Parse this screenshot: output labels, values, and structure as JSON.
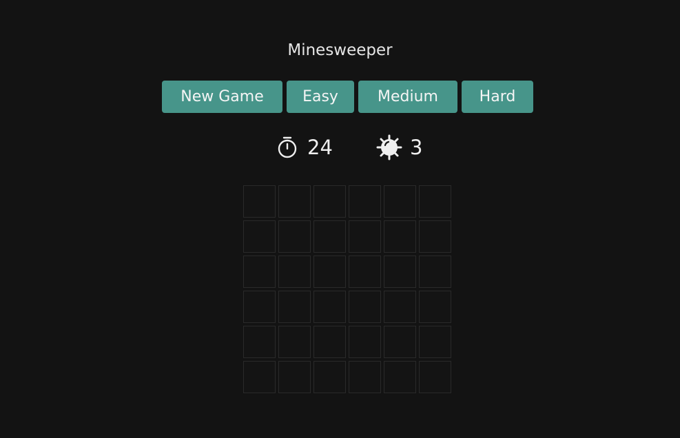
{
  "game": {
    "title": "Minesweeper"
  },
  "toolbar": {
    "buttons": [
      {
        "key": "new",
        "label": "New Game"
      },
      {
        "key": "easy",
        "label": "Easy"
      },
      {
        "key": "medium",
        "label": "Medium"
      },
      {
        "key": "hard",
        "label": "Hard"
      }
    ]
  },
  "stats": {
    "timer": {
      "icon": "stopwatch-icon",
      "value": "24"
    },
    "mines": {
      "icon": "mine-icon",
      "value": "3"
    }
  },
  "board": {
    "rows": 6,
    "cols": 6,
    "cells_state": "hidden"
  },
  "colors": {
    "background": "#131313",
    "button": "#47958a",
    "cell_border": "#2a2a2a",
    "text": "#e8e8e8"
  }
}
